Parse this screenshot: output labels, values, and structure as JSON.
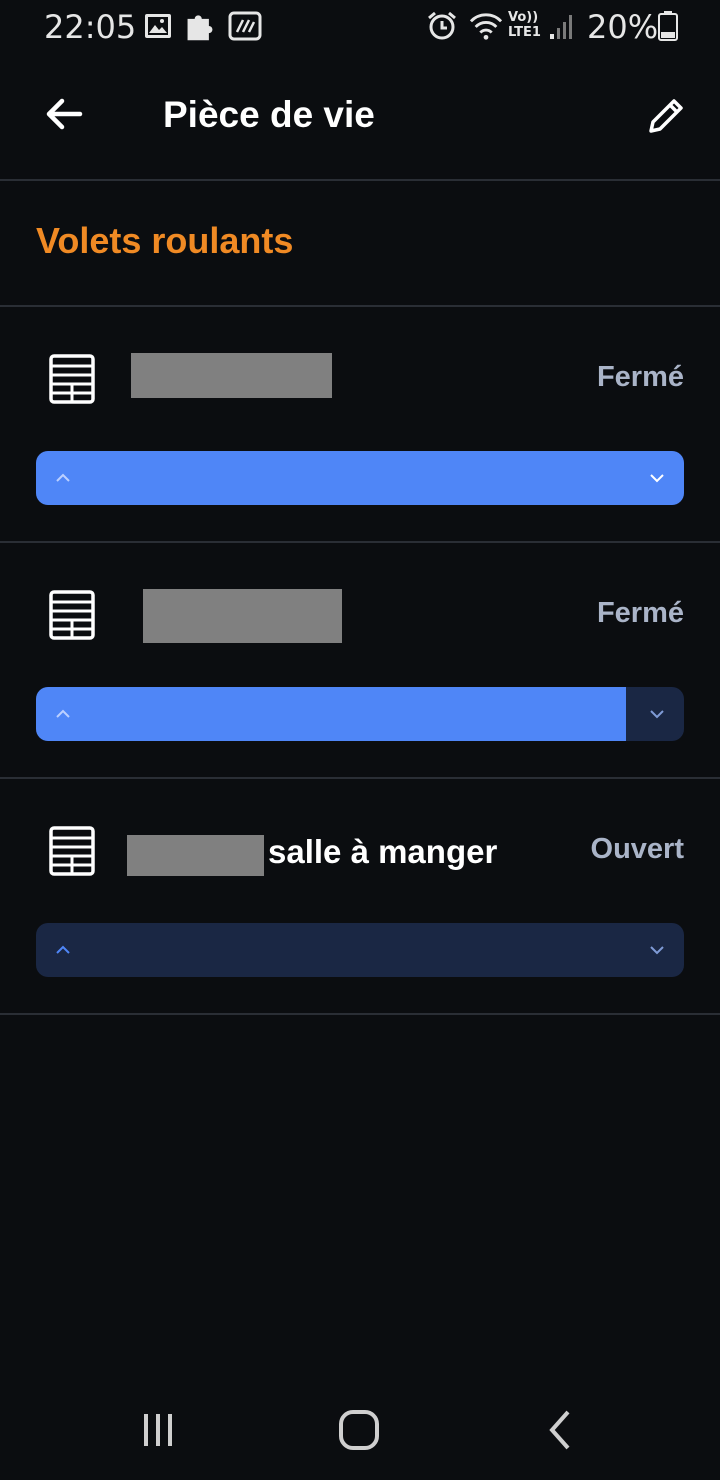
{
  "status_bar": {
    "time": "22:05",
    "battery_percent": "20%",
    "network_label_top": "Vo))",
    "network_label_bottom": "LTE1"
  },
  "header": {
    "title": "Pièce de vie"
  },
  "section": {
    "title": "Volets roulants"
  },
  "devices": [
    {
      "name": "",
      "status": "Fermé",
      "position_fraction": 1.0
    },
    {
      "name": "",
      "status": "Fermé",
      "position_fraction": 0.91
    },
    {
      "name": "salle à manger",
      "status": "Ouvert",
      "position_fraction": 0.0
    }
  ],
  "colors": {
    "accent_orange": "#f08a24",
    "slider_fill": "#4f86f7",
    "slider_track": "#1a2744",
    "status_text": "#aab4c8"
  },
  "icons": {
    "back": "arrow-left-icon",
    "edit": "pencil-icon",
    "shutter": "roller-shutter-icon",
    "slider_up": "chevron-up-icon",
    "slider_down": "chevron-down-icon"
  }
}
